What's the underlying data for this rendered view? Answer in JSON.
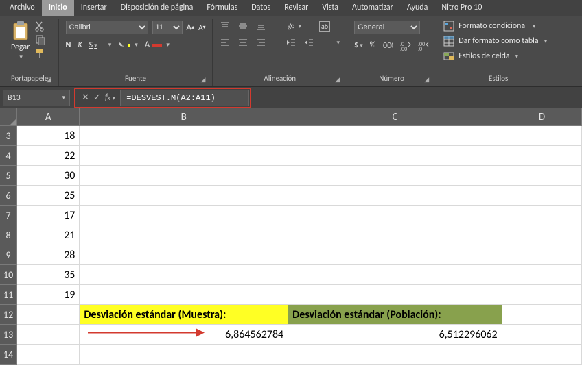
{
  "menu": {
    "items": [
      "Archivo",
      "Inicio",
      "Insertar",
      "Disposición de página",
      "Fórmulas",
      "Datos",
      "Revisar",
      "Vista",
      "Automatizar",
      "Ayuda",
      "Nitro Pro 10"
    ],
    "active_index": 1
  },
  "ribbon": {
    "clipboard": {
      "title": "Portapapeles",
      "paste_label": "Pegar"
    },
    "font": {
      "title": "Fuente",
      "family": "Calibri",
      "size": "11",
      "buttons": {
        "bold": "N",
        "italic": "K",
        "underline": "S"
      },
      "fill_color": "#ffff24",
      "text_color": "#d33a2f"
    },
    "align": {
      "title": "Alineación",
      "wrap_label": "ab"
    },
    "number": {
      "title": "Número",
      "format": "General"
    },
    "styles": {
      "title": "Estilos",
      "conditional_label": "Formato condicional",
      "table_label": "Dar formato como tabla",
      "cellstyles_label": "Estilos de celda"
    }
  },
  "formula_bar": {
    "cell_ref": "B13",
    "formula": "=DESVEST.M(A2:A11)"
  },
  "sheet": {
    "columns": [
      "A",
      "B",
      "C",
      "D"
    ],
    "rows": [
      "3",
      "4",
      "5",
      "6",
      "7",
      "8",
      "9",
      "10",
      "11",
      "12",
      "13",
      "14"
    ],
    "dataA": {
      "3": "18",
      "4": "22",
      "5": "30",
      "6": "25",
      "7": "17",
      "8": "21",
      "9": "28",
      "10": "35",
      "11": "19"
    },
    "label_sample": "Desviación estándar (Muestra):",
    "label_pop": "Desviación estándar (Población):",
    "val_sample": "6,864562784",
    "val_pop": "6,512296062"
  }
}
